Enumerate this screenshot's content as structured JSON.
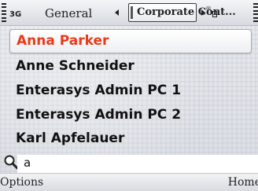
{
  "status": {
    "network": "3G"
  },
  "tabs": {
    "inactive_label": "General",
    "active_label": "Corporate Cont..."
  },
  "contacts": [
    {
      "name": "Anna Parker",
      "selected": true
    },
    {
      "name": "Anne Schneider",
      "selected": false
    },
    {
      "name": "Enterasys Admin PC 1",
      "selected": false
    },
    {
      "name": "Enterasys Admin PC 2",
      "selected": false
    },
    {
      "name": "Karl Apfelauer",
      "selected": false
    }
  ],
  "search": {
    "value": "a"
  },
  "softkeys": {
    "left": "Options",
    "right": "Home"
  },
  "colors": {
    "selected_text": "#ea3a1a",
    "text": "#111111"
  },
  "icons": [
    "signal-icon",
    "tab-left-arrow-icon",
    "tab-right-arrow-icon",
    "message-icon",
    "battery-icon",
    "search-icon"
  ]
}
